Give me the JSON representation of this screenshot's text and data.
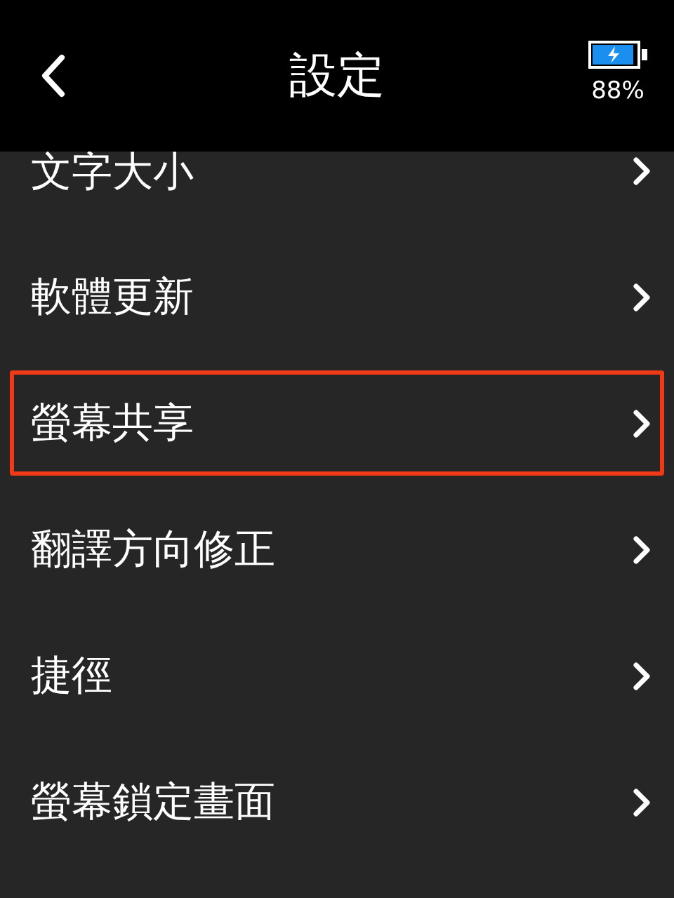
{
  "header": {
    "title": "設定",
    "battery_text": "88%"
  },
  "items": [
    {
      "label": "文字大小",
      "selected": false
    },
    {
      "label": "軟體更新",
      "selected": false
    },
    {
      "label": "螢幕共享",
      "selected": true
    },
    {
      "label": "翻譯方向修正",
      "selected": false
    },
    {
      "label": "捷徑",
      "selected": false
    },
    {
      "label": "螢幕鎖定畫面",
      "selected": false
    }
  ]
}
